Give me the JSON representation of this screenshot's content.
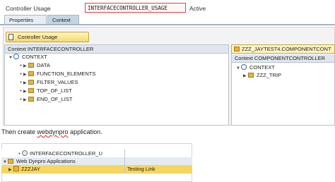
{
  "header": {
    "label": "Controller Usage",
    "field_value": "INTERFACECONTROLLER_USAGE",
    "status": "Active"
  },
  "tabs": [
    {
      "label": "Properties"
    },
    {
      "label": "Context"
    }
  ],
  "toolbar": {
    "usage_button": "Controller Usage"
  },
  "left_context": {
    "title": "Context INTERFACECONTROLLER",
    "root": "CONTEXT",
    "nodes": [
      "DATA",
      "FUNCTION_ELEMENTS",
      "FILTER_VALUES",
      "TOP_OF_LIST",
      "END_OF_LIST"
    ]
  },
  "right_context": {
    "component": "ZZZ_JAYTEST4.COMPONENTCONT",
    "title": "Context COMPONENTCONTROLLER",
    "root": "CONTEXT",
    "nodes": [
      "ZZZ_TRIP"
    ]
  },
  "instruction": {
    "prefix": "Then create ",
    "keyword": "webdynpro",
    "suffix": " application."
  },
  "bottom_tree": {
    "row1": "INTERFACECONTROLLER_U",
    "row2": "Web Dynpro Applications",
    "row3_name": "ZZZJAY",
    "row3_desc": "Testing Link"
  }
}
